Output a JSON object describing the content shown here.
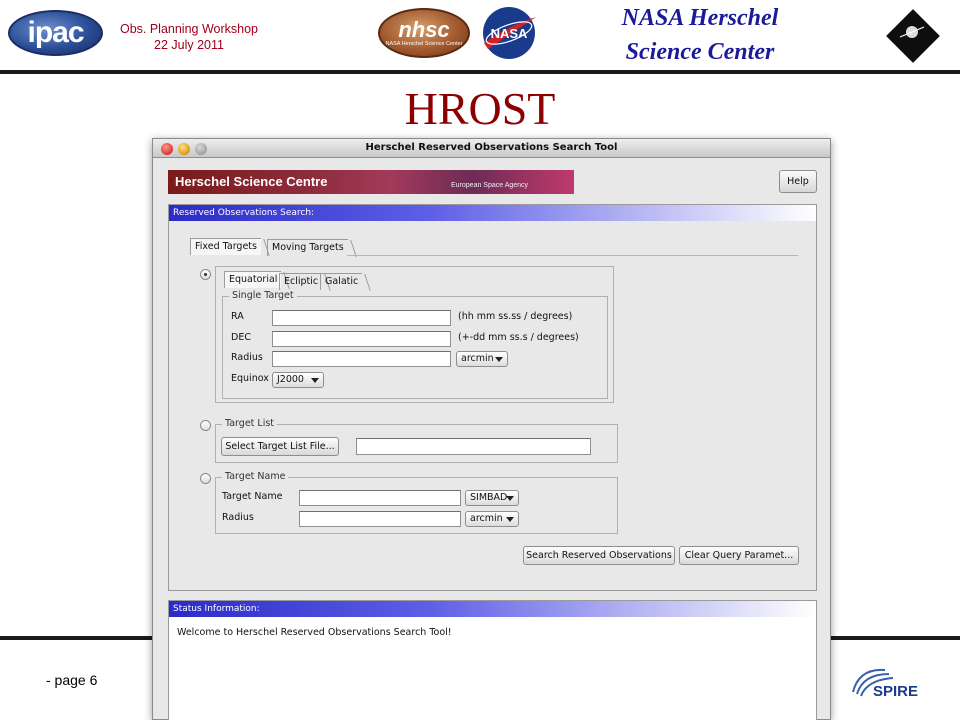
{
  "header": {
    "ipac_logo_text": "ipac",
    "workshop_line1": "Obs. Planning Workshop",
    "workshop_line2": "22 July 2011",
    "nhsc_logo_big": "nhsc",
    "nhsc_logo_small": "NASA Herschel Science Center",
    "nasa_logo_text": "NASA",
    "center_line1": "NASA Herschel",
    "center_line2": "Science Center",
    "slide_title": "HROST"
  },
  "footer": {
    "page": "- page 6",
    "spire_logo_text": "SPIRE"
  },
  "window": {
    "title": "Herschel Reserved Observations Search Tool",
    "banner_title": "Herschel Science Centre",
    "banner_sub": "European Space Agency",
    "help_button": "Help"
  },
  "search_panel": {
    "header": "Reserved Observations Search:",
    "tabs": [
      "Fixed Targets",
      "Moving Targets"
    ],
    "coord_tabs": [
      "Equatorial",
      "Ecliptic",
      "Galatic"
    ],
    "single_target": {
      "legend": "Single Target",
      "ra_label": "RA",
      "ra_value": "",
      "ra_hint": "(hh mm ss.ss / degrees)",
      "dec_label": "DEC",
      "dec_value": "",
      "dec_hint": "(+-dd mm ss.s / degrees)",
      "radius_label": "Radius",
      "radius_value": "",
      "radius_unit": "arcmin",
      "equinox_label": "Equinox",
      "equinox_value": "J2000"
    },
    "target_list": {
      "legend": "Target List",
      "select_button": "Select Target List File...",
      "file_value": ""
    },
    "target_name": {
      "legend": "Target Name",
      "name_label": "Target Name",
      "name_value": "",
      "resolver": "SIMBAD",
      "radius_label": "Radius",
      "radius_value": "",
      "radius_unit": "arcmin"
    },
    "search_button": "Search Reserved Observations",
    "clear_button": "Clear Query Paramet..."
  },
  "status_panel": {
    "header": "Status Information:",
    "message": "Welcome to Herschel Reserved Observations Search Tool!"
  }
}
